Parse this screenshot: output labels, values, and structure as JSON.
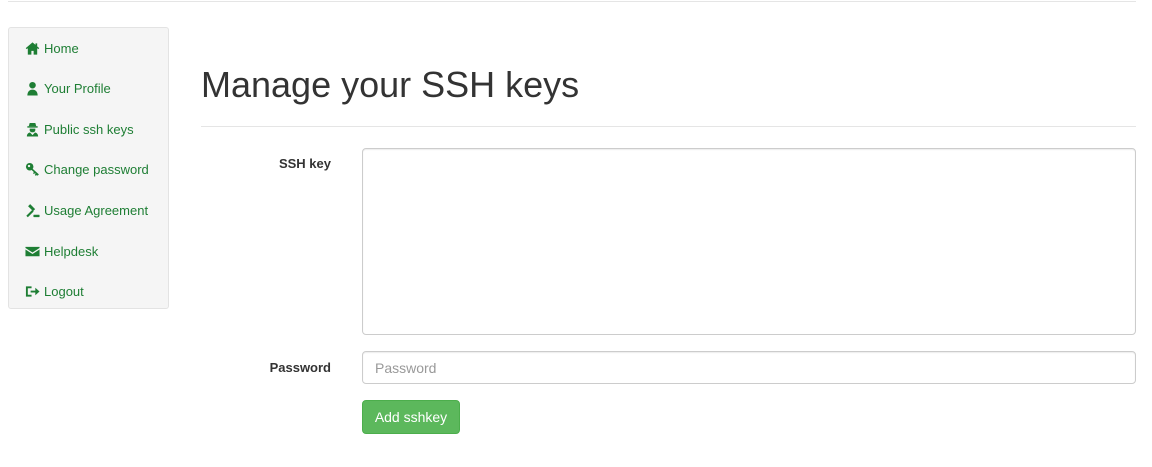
{
  "sidebar": {
    "accent_color": "#1e7e34",
    "items": [
      {
        "label": "Home",
        "icon": "home-icon"
      },
      {
        "label": "Your Profile",
        "icon": "user-icon"
      },
      {
        "label": "Public ssh keys",
        "icon": "user-secret-icon"
      },
      {
        "label": "Change password",
        "icon": "key-icon"
      },
      {
        "label": "Usage Agreement",
        "icon": "gavel-icon"
      },
      {
        "label": "Helpdesk",
        "icon": "envelope-icon"
      },
      {
        "label": "Logout",
        "icon": "sign-out-icon"
      }
    ]
  },
  "main": {
    "title": "Manage your SSH keys",
    "form": {
      "sshkey_label": "SSH key",
      "sshkey_value": "",
      "password_label": "Password",
      "password_placeholder": "Password",
      "password_value": "",
      "submit_label": "Add sshkey",
      "submit_color": "#5cb85c"
    }
  }
}
